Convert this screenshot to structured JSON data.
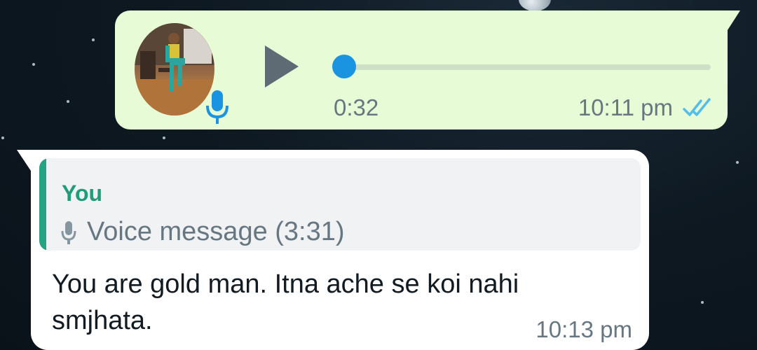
{
  "outgoing_voice_message": {
    "avatar_icon": "avatar",
    "mic_icon": "mic-icon",
    "play_icon": "play-icon",
    "progress": 0,
    "duration": "0:32",
    "time": "10:11 pm",
    "status_icon": "double-check-icon",
    "bubble_color": "#e7fcd6",
    "accent_color": "#1a94e0",
    "tick_color": "#53bdeb"
  },
  "incoming_message": {
    "quoted": {
      "author": "You",
      "icon": "mic-icon",
      "preview": "Voice message (3:31)",
      "accent_color": "#25a483"
    },
    "text": "You are gold man. Itna ache se koi nahi smjhata.",
    "time": "10:13 pm",
    "bubble_color": "#ffffff"
  }
}
